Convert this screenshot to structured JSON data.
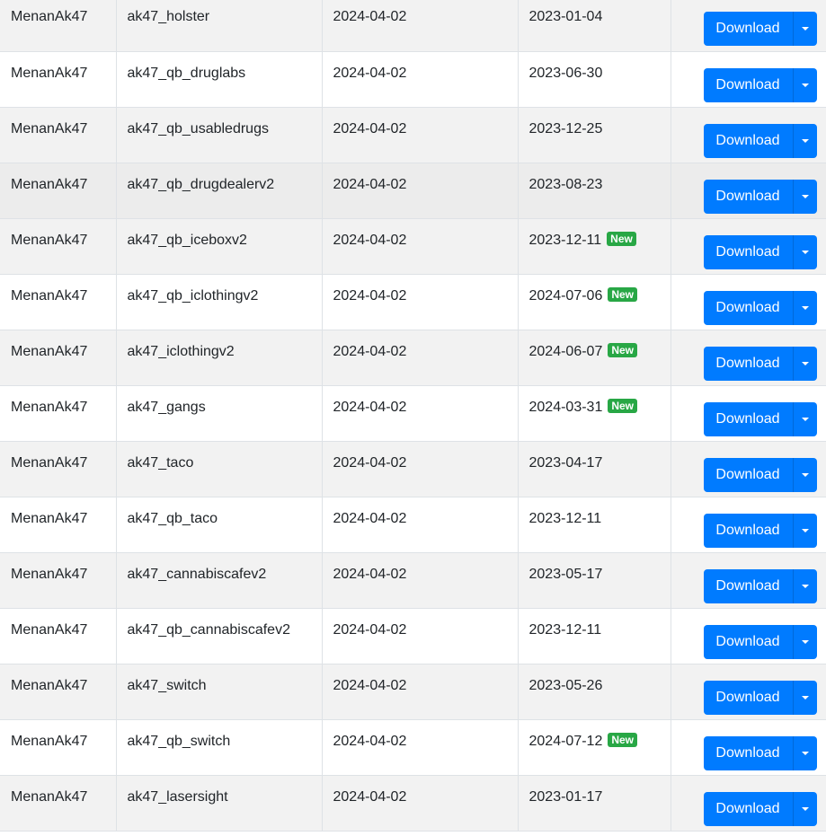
{
  "table": {
    "download_label": "Download",
    "new_badge_label": "New",
    "rows": [
      {
        "author": "MenanAk47",
        "name": "ak47_holster",
        "added": "2024-04-02",
        "updated": "2023-01-04",
        "is_new": false
      },
      {
        "author": "MenanAk47",
        "name": "ak47_qb_druglabs",
        "added": "2024-04-02",
        "updated": "2023-06-30",
        "is_new": false
      },
      {
        "author": "MenanAk47",
        "name": "ak47_qb_usabledrugs",
        "added": "2024-04-02",
        "updated": "2023-12-25",
        "is_new": false
      },
      {
        "author": "MenanAk47",
        "name": "ak47_qb_drugdealerv2",
        "added": "2024-04-02",
        "updated": "2023-08-23",
        "is_new": false
      },
      {
        "author": "MenanAk47",
        "name": "ak47_qb_iceboxv2",
        "added": "2024-04-02",
        "updated": "2023-12-11",
        "is_new": true
      },
      {
        "author": "MenanAk47",
        "name": "ak47_qb_iclothingv2",
        "added": "2024-04-02",
        "updated": "2024-07-06",
        "is_new": true
      },
      {
        "author": "MenanAk47",
        "name": "ak47_iclothingv2",
        "added": "2024-04-02",
        "updated": "2024-06-07",
        "is_new": true
      },
      {
        "author": "MenanAk47",
        "name": "ak47_gangs",
        "added": "2024-04-02",
        "updated": "2024-03-31",
        "is_new": true
      },
      {
        "author": "MenanAk47",
        "name": "ak47_taco",
        "added": "2024-04-02",
        "updated": "2023-04-17",
        "is_new": false
      },
      {
        "author": "MenanAk47",
        "name": "ak47_qb_taco",
        "added": "2024-04-02",
        "updated": "2023-12-11",
        "is_new": false
      },
      {
        "author": "MenanAk47",
        "name": "ak47_cannabiscafev2",
        "added": "2024-04-02",
        "updated": "2023-05-17",
        "is_new": false
      },
      {
        "author": "MenanAk47",
        "name": "ak47_qb_cannabiscafev2",
        "added": "2024-04-02",
        "updated": "2023-12-11",
        "is_new": false
      },
      {
        "author": "MenanAk47",
        "name": "ak47_switch",
        "added": "2024-04-02",
        "updated": "2023-05-26",
        "is_new": false
      },
      {
        "author": "MenanAk47",
        "name": "ak47_qb_switch",
        "added": "2024-04-02",
        "updated": "2024-07-12",
        "is_new": true
      },
      {
        "author": "MenanAk47",
        "name": "ak47_lasersight",
        "added": "2024-04-02",
        "updated": "2023-01-17",
        "is_new": false
      }
    ]
  }
}
